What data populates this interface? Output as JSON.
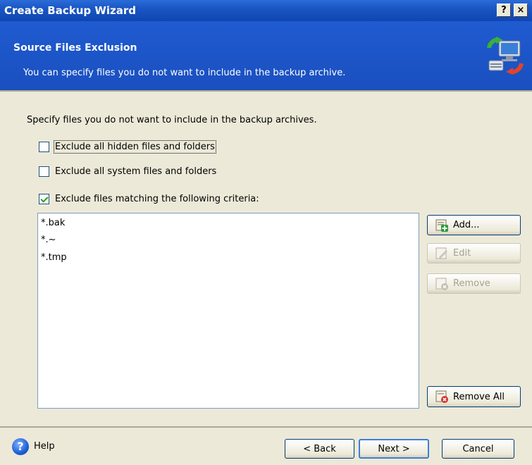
{
  "window": {
    "title": "Create Backup Wizard",
    "help_btn": "?",
    "close_btn": "×"
  },
  "header": {
    "title": "Source Files Exclusion",
    "subtitle": "You can specify files you do not want to include in the backup archive."
  },
  "content": {
    "intro": "Specify files you do not want to include in the backup archives.",
    "options": [
      {
        "label": "Exclude all hidden files and folders",
        "checked": false
      },
      {
        "label": "Exclude all system files and folders",
        "checked": false
      },
      {
        "label": "Exclude files matching the following criteria:",
        "checked": true
      }
    ],
    "criteria": [
      "*.bak",
      "*.~",
      "*.tmp"
    ]
  },
  "side_buttons": {
    "add": "Add...",
    "edit": "Edit",
    "remove": "Remove",
    "remove_all": "Remove All"
  },
  "footer": {
    "help": "Help",
    "back": "< Back",
    "next": "Next >",
    "cancel": "Cancel"
  }
}
